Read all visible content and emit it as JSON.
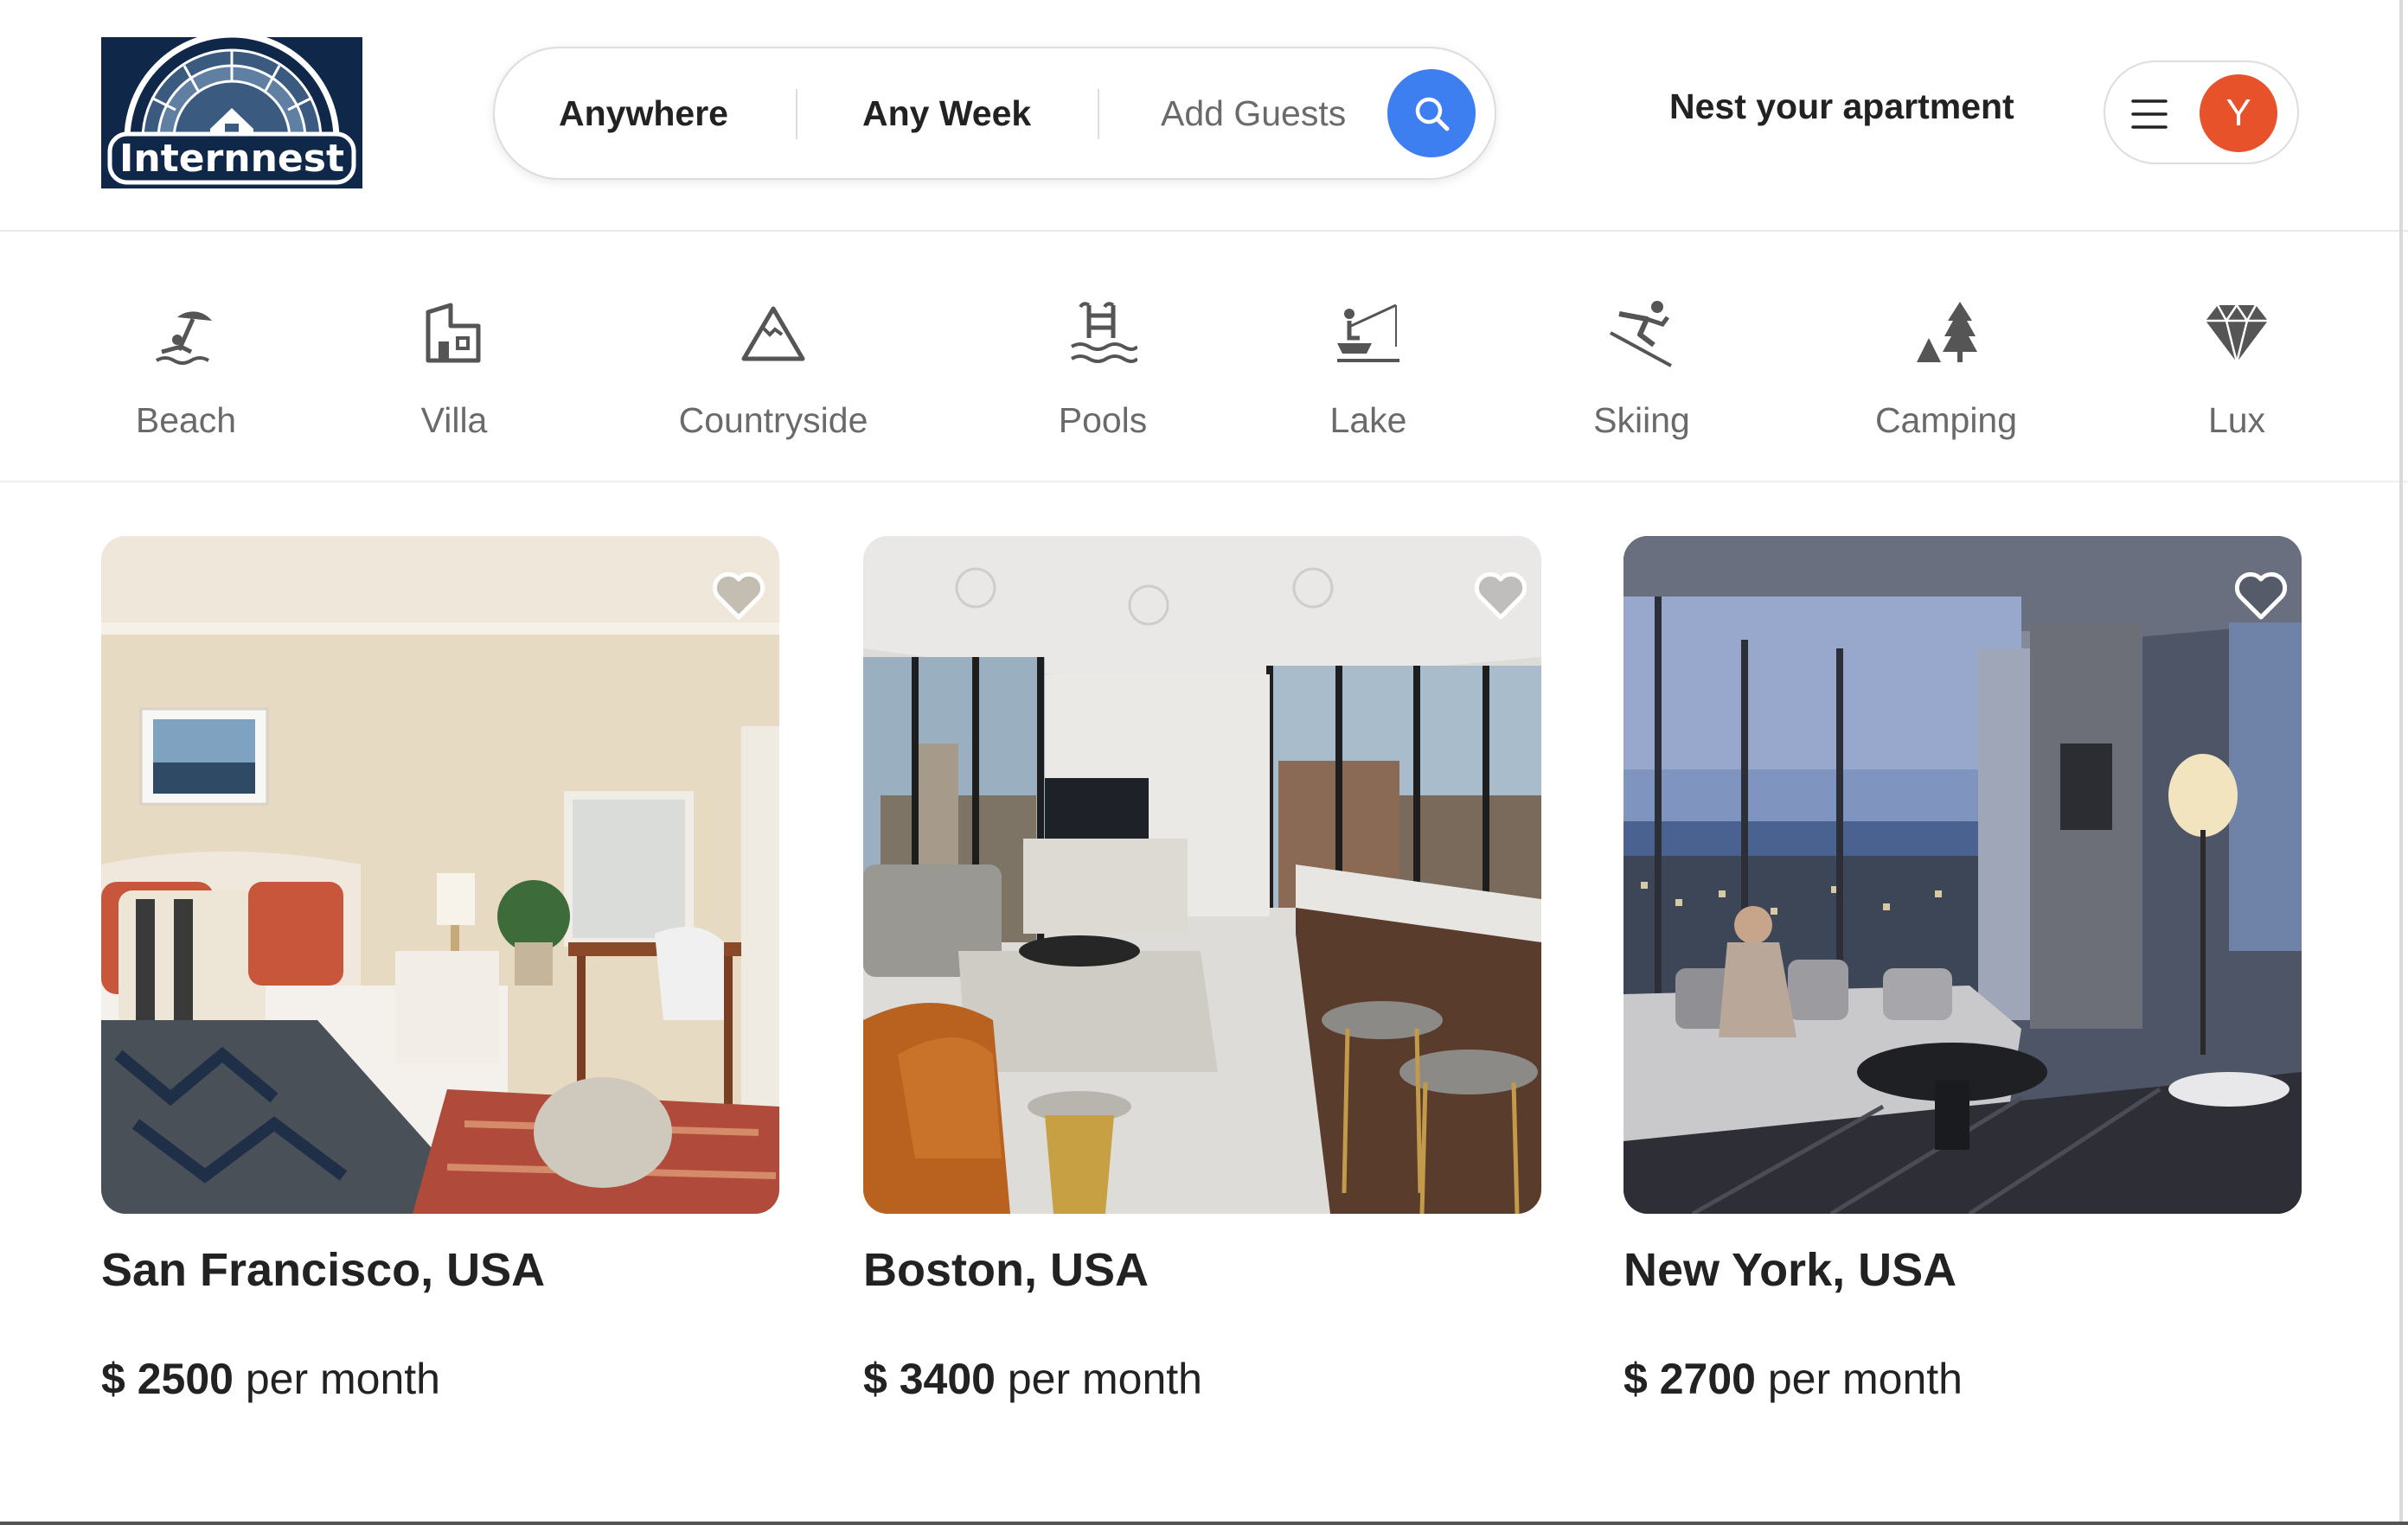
{
  "logo": {
    "text": "Internnest"
  },
  "search": {
    "where_label": "Anywhere",
    "when_label": "Any Week",
    "guests_placeholder": "Add Guests",
    "button_icon": "search-icon",
    "accent_color": "#3d7ef0"
  },
  "header": {
    "host_link": "Nest your apartment",
    "menu_icon": "hamburger-icon",
    "avatar_initial": "Y",
    "avatar_color": "#e8522a"
  },
  "categories": [
    {
      "label": "Beach",
      "icon": "beach-umbrella-icon"
    },
    {
      "label": "Villa",
      "icon": "villa-icon"
    },
    {
      "label": "Countryside",
      "icon": "mountain-icon"
    },
    {
      "label": "Pools",
      "icon": "pool-ladder-icon"
    },
    {
      "label": "Lake",
      "icon": "lake-fishing-icon"
    },
    {
      "label": "Skiing",
      "icon": "skier-icon"
    },
    {
      "label": "Camping",
      "icon": "camping-tent-tree-icon"
    },
    {
      "label": "Lux",
      "icon": "diamond-icon"
    }
  ],
  "listings": [
    {
      "title": "San Francisco, USA",
      "currency": "$",
      "price": "2500",
      "unit": "per month",
      "favorite_icon": "heart-outline-icon"
    },
    {
      "title": "Boston, USA",
      "currency": "$",
      "price": "3400",
      "unit": "per month",
      "favorite_icon": "heart-outline-icon"
    },
    {
      "title": "New York, USA",
      "currency": "$",
      "price": "2700",
      "unit": "per month",
      "favorite_icon": "heart-outline-icon"
    }
  ]
}
